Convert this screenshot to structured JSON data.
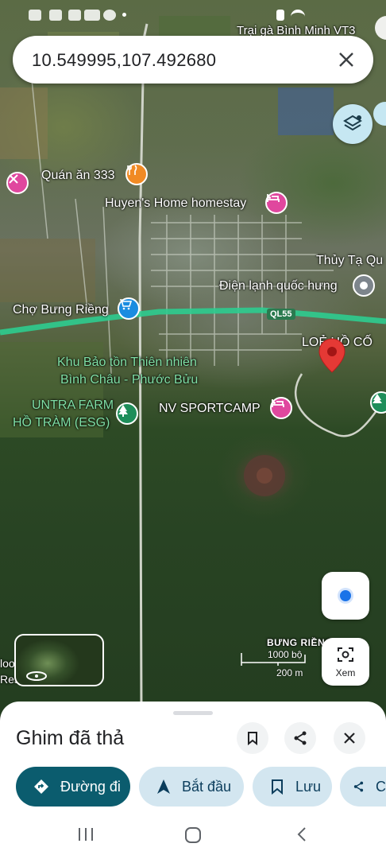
{
  "search": {
    "query": "10.549995,107.492680"
  },
  "map": {
    "top_poi_label": "Trại gà Bình Minh VT3",
    "labels": {
      "quan_an": "Quán ăn 333",
      "homestay": "Huyen's Home homestay",
      "thuy_ta": "Thủy Tạ Qu",
      "dien_lanh": "Điện lạnh quốc hưng",
      "cho": "Chợ Bưng Riềng",
      "road": "QL55",
      "lo_ho": "LOẺ HỒ CỐ",
      "khu_bao_ton_1": "Khu Bảo tồn Thiên nhiên",
      "khu_bao_ton_2": "Bình Châu - Phước Bửu",
      "untra_1": "UNTRA FARM",
      "untra_2": "HỒ TRÀM (ESG)",
      "sportcamp": "NV SPORTCAMP",
      "bung_rieng": "BƯNG RIỀNG",
      "edge_1": "loo",
      "edge_2": "Res"
    },
    "scale": {
      "imperial": "1000 bộ",
      "metric": "200 m"
    },
    "lens_label": "Xem"
  },
  "sheet": {
    "title": "Ghim đã thả",
    "actions": {
      "directions": "Đường đi",
      "start": "Bắt đầu",
      "save": "Lưu",
      "share": "C"
    }
  },
  "colors": {
    "primary": "#0b5c6e",
    "chip": "#d3e6f0",
    "pin": "#e53935",
    "road": "#2ecc8f"
  }
}
